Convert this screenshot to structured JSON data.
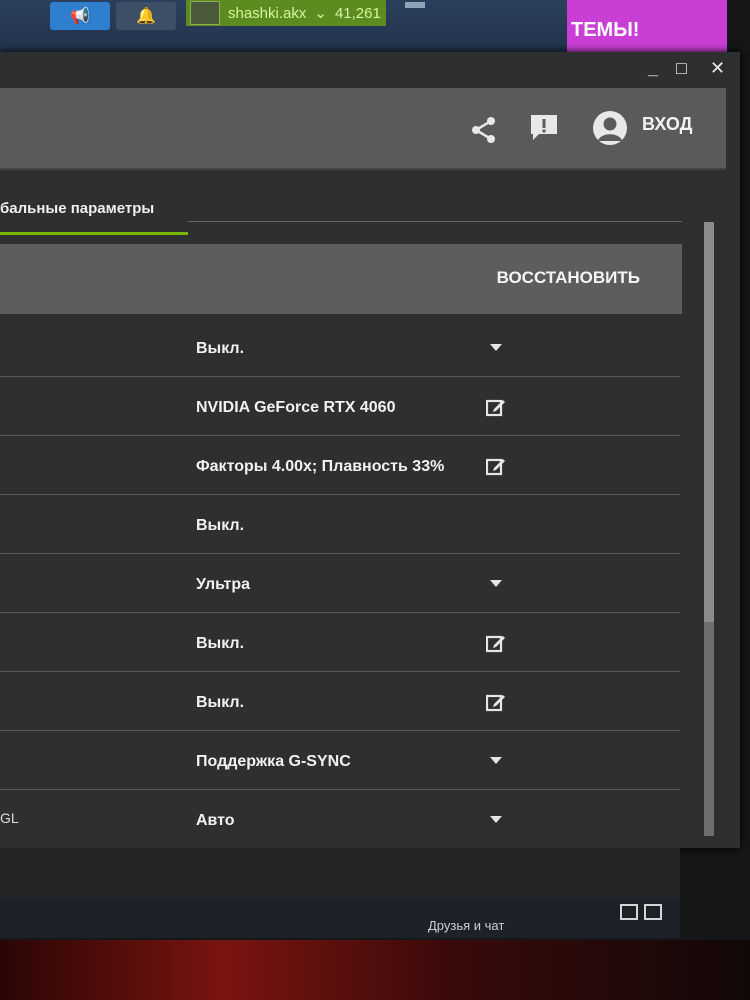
{
  "background": {
    "user_name": "shashki.akx",
    "user_points": "41,261",
    "banner_text": "ТЕМЫ!",
    "friends_chat": "Друзья и чат"
  },
  "window": {
    "controls": [
      "_",
      "□",
      "✕"
    ],
    "login_label": "ВХОД"
  },
  "tab": {
    "label": "бальные параметры"
  },
  "restore_label": "ВОССТАНОВИТЬ",
  "settings": [
    {
      "label": "",
      "value": "Выкл.",
      "action": "chevron-down"
    },
    {
      "label": "",
      "value": "NVIDIA GeForce RTX 4060",
      "action": "edit"
    },
    {
      "label": "",
      "value": "Факторы 4.00x; Плавность 33%",
      "action": "edit"
    },
    {
      "label": "",
      "value": "Выкл.",
      "action": ""
    },
    {
      "label": "",
      "value": "Ультра",
      "action": "chevron-down"
    },
    {
      "label": "",
      "value": "Выкл.",
      "action": "edit"
    },
    {
      "label": "",
      "value": "Выкл.",
      "action": "edit"
    },
    {
      "label": "",
      "value": "Поддержка G-SYNC",
      "action": "chevron-down"
    },
    {
      "label": "GL",
      "value": "Авто",
      "action": "chevron-down"
    }
  ],
  "colors": {
    "accent": "#76b900",
    "header": "#5a5b59",
    "panel": "#2e2f2f"
  }
}
